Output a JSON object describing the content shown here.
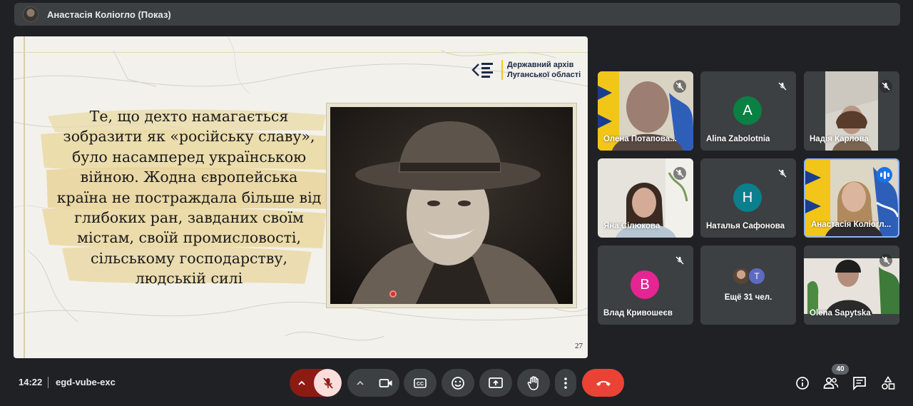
{
  "presenter": {
    "title": "Анастасія Коліогло (Показ)"
  },
  "slide": {
    "logo_line1": "Державний архів",
    "logo_line2": "Луганської області",
    "quote_lines": [
      "Те, що дехто намагається",
      "зобразити як «російську славу»,",
      "було насамперед українською",
      "війною. Жодна європейська",
      "країна не постраждала більше від",
      "глибоких ран, завданих своїм",
      "містам, своїй промисловості,",
      "сільському господарству,",
      "людській силі"
    ],
    "page_number": "27",
    "accent_color": "#f2c619"
  },
  "participants": [
    {
      "name": "Олена Потапова...",
      "type": "video",
      "mic": "off"
    },
    {
      "name": "Alina Zabolotnia",
      "type": "letter",
      "letter": "A",
      "color": "#0b8043",
      "mic": "off"
    },
    {
      "name": "Надія Карлова",
      "type": "video",
      "mic": "off"
    },
    {
      "name": "Яна Сілюкова",
      "type": "video",
      "mic": "off"
    },
    {
      "name": "Наталья Сафонова",
      "type": "letter",
      "letter": "Н",
      "color": "#0b7f8c",
      "mic": "off"
    },
    {
      "name": "Анастасія Коліогл...",
      "type": "video",
      "mic": "speaking"
    },
    {
      "name": "Влад Кривошеєв",
      "type": "letter",
      "letter": "В",
      "color": "#e52592",
      "mic": "off"
    },
    {
      "name": "Ещё 31 чел.",
      "type": "more",
      "letter": "T"
    },
    {
      "name": "Olena Sapytska",
      "type": "video",
      "mic": "off"
    }
  ],
  "footer": {
    "time": "14:22",
    "meeting_code": "egd-vube-exc",
    "people_count": "40"
  },
  "icons": {
    "chevron": "chevron-up-icon",
    "mic": "mic-off-icon",
    "camera": "camera-icon",
    "captions": "captions-icon",
    "emoji": "emoji-icon",
    "present": "present-screen-icon",
    "hand": "raise-hand-icon",
    "more": "more-vert-icon",
    "end": "end-call-icon",
    "info": "info-icon",
    "people": "people-icon",
    "chat": "chat-icon",
    "activities": "activities-icon"
  }
}
